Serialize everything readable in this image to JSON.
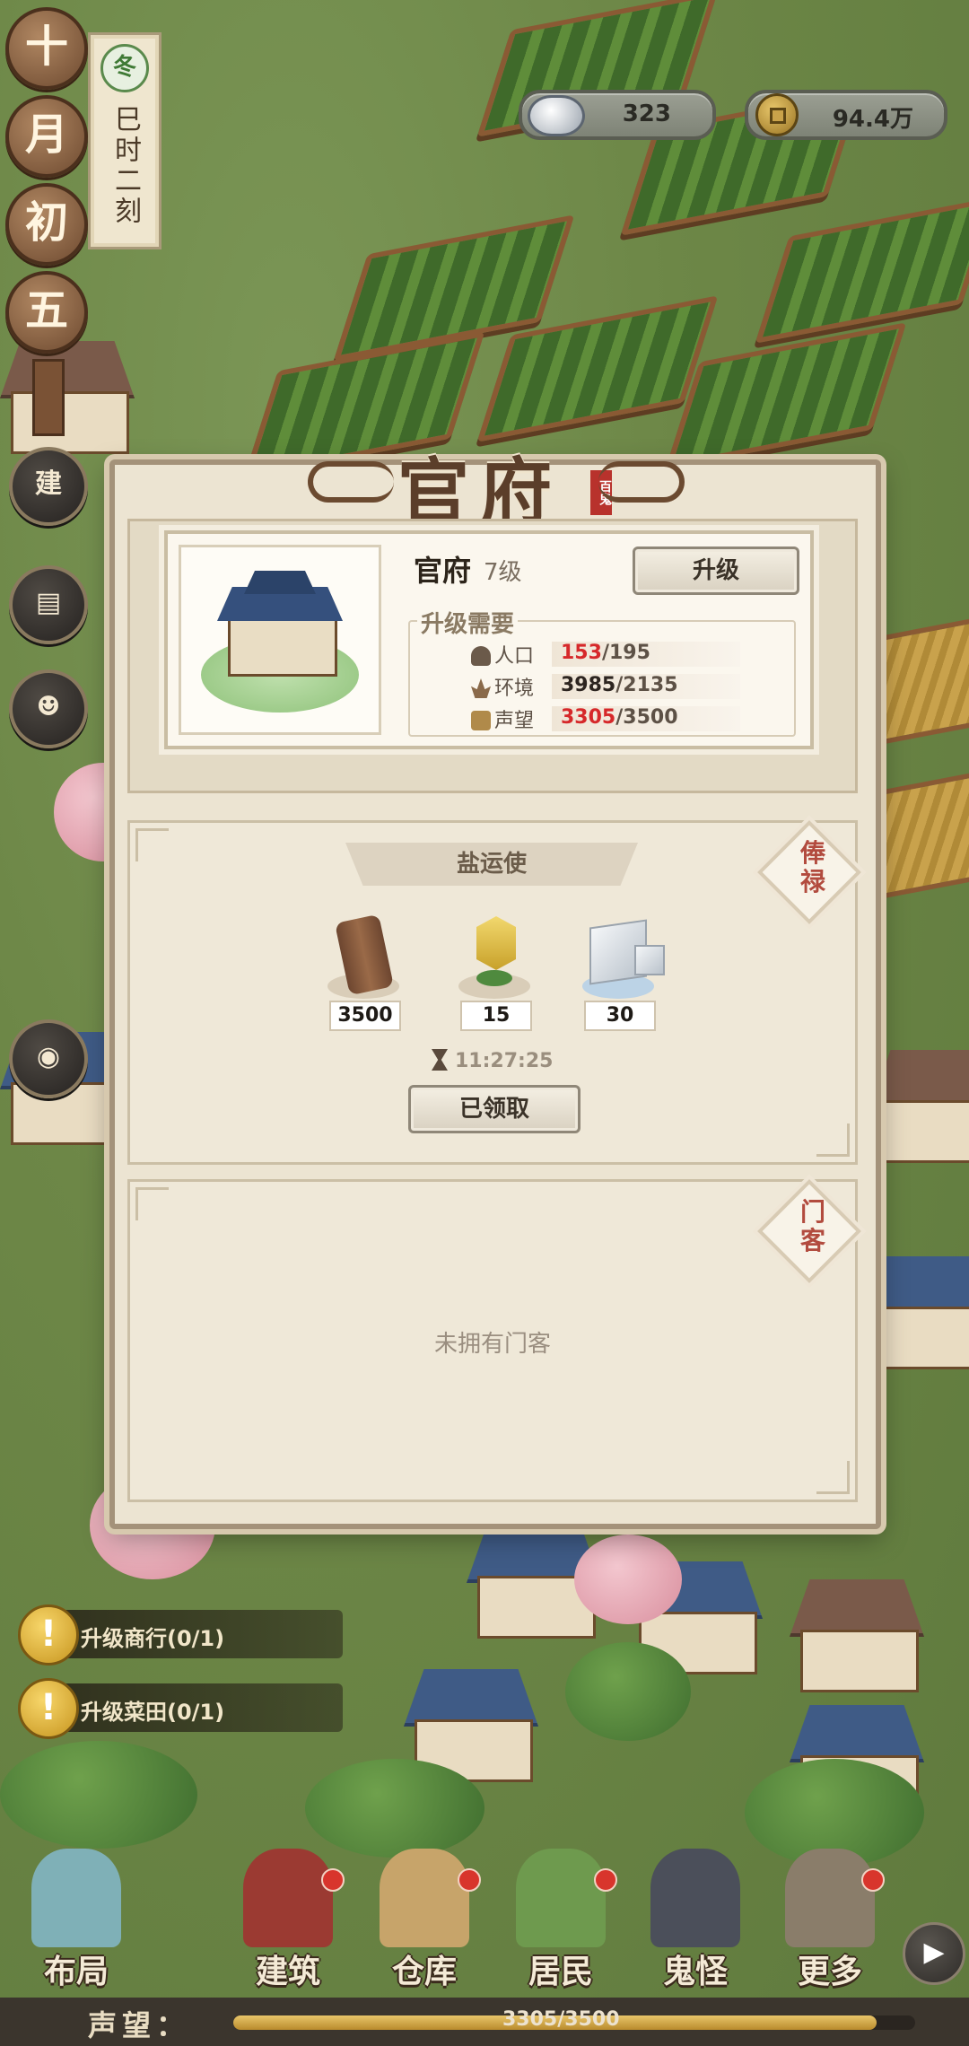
{
  "calendar": {
    "chars": [
      "十",
      "月",
      "初",
      "五"
    ],
    "season": "冬",
    "time": "巳时二刻"
  },
  "resources": {
    "silver": "323",
    "coins": "94.4万"
  },
  "side_buttons": {
    "build": "建"
  },
  "quests": [
    {
      "label": "升级商行",
      "progress": "(0/1)"
    },
    {
      "label": "升级菜田",
      "progress": "(0/1)"
    }
  ],
  "modal": {
    "title": "官府",
    "seal": "百鬼",
    "building": {
      "name": "官府",
      "level": "7级",
      "upgrade_button": "升级"
    },
    "requirements": {
      "title": "升级需要",
      "rows": [
        {
          "label": "人口",
          "current": "153",
          "required": "/195",
          "met": false,
          "icon": "person-icon"
        },
        {
          "label": "环境",
          "current": "3985",
          "required": "/2135",
          "met": true,
          "icon": "lotus-icon"
        },
        {
          "label": "声望",
          "current": "3305",
          "required": "/3500",
          "met": false,
          "icon": "scroll-icon"
        }
      ]
    },
    "salary": {
      "tab": "俸禄",
      "position": "盐运使",
      "items": [
        {
          "name": "wood-log-icon",
          "count": "3500"
        },
        {
          "name": "gold-token-icon",
          "count": "15"
        },
        {
          "name": "salt-block-icon",
          "count": "30"
        }
      ],
      "timer": "11:27:25",
      "claim_button": "已领取"
    },
    "guests": {
      "tab": "门客",
      "empty_text": "未拥有门客"
    }
  },
  "nav": [
    {
      "label": "布局",
      "dot": false
    },
    {
      "label": "建筑",
      "dot": true
    },
    {
      "label": "仓库",
      "dot": true
    },
    {
      "label": "居民",
      "dot": true
    },
    {
      "label": "鬼怪",
      "dot": false
    },
    {
      "label": "更多",
      "dot": true
    }
  ],
  "fame": {
    "label": "声望：",
    "value": "3305/3500",
    "fraction": 0.944
  },
  "colors": {
    "accent_red": "#d6282a",
    "panel_bg": "#ece4d2",
    "frame": "#a4927a"
  }
}
